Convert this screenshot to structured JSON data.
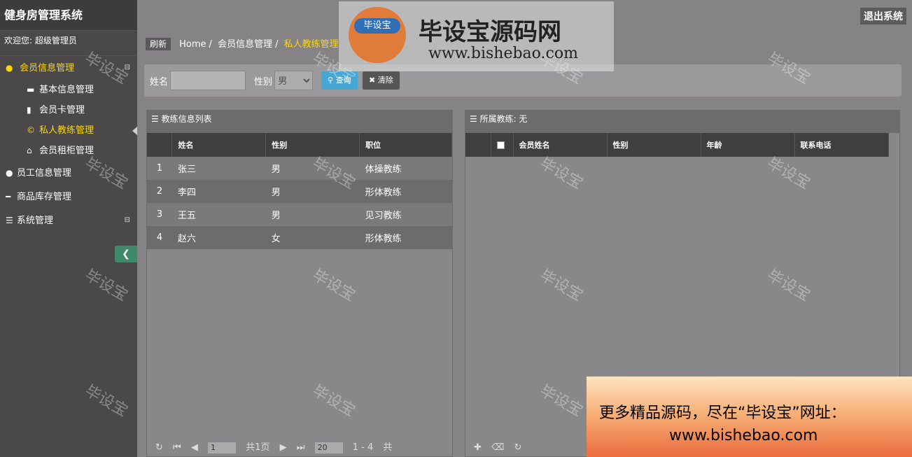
{
  "app": {
    "title": "健身房管理系统",
    "welcome": "欢迎您: 超级管理员",
    "logout": "退出系统"
  },
  "sidebar": {
    "member_group": "会员信息管理",
    "member_items": [
      "基本信息管理",
      "会员卡管理",
      "私人教练管理",
      "会员租柜管理"
    ],
    "staff": "员工信息管理",
    "goods": "商品库存管理",
    "system": "系统管理"
  },
  "breadcrumb": {
    "refresh": "刷新",
    "home": "Home",
    "level1": "会员信息管理",
    "current": "私人教练管理"
  },
  "search": {
    "name_label": "姓名",
    "name_value": "",
    "gender_label": "性别",
    "gender_value": "男",
    "query": "查询",
    "clear": "清除"
  },
  "left_panel": {
    "title": "教练信息列表",
    "headers": [
      "姓名",
      "性别",
      "职位"
    ],
    "rows": [
      [
        "1",
        "张三",
        "男",
        "体操教练"
      ],
      [
        "2",
        "李四",
        "男",
        "形体教练"
      ],
      [
        "3",
        "王五",
        "男",
        "见习教练"
      ],
      [
        "4",
        "赵六",
        "女",
        "形体教练"
      ]
    ],
    "pager": {
      "page": "1",
      "total_pages": "共1页",
      "page_size": "20",
      "range": "1 - 4",
      "total": "共"
    }
  },
  "right_panel": {
    "title": "所属教练: 无",
    "headers": [
      "会员姓名",
      "性别",
      "年龄",
      "联系电话"
    ]
  },
  "watermark": {
    "text": "毕设宝",
    "banner_title": "毕设宝源码网",
    "banner_url": "www.bishebao.com",
    "logo_text": "毕设宝"
  },
  "ad": {
    "line1": "更多精品源码，尽在“毕设宝”网址：",
    "line2": "www.bishebao.com"
  }
}
